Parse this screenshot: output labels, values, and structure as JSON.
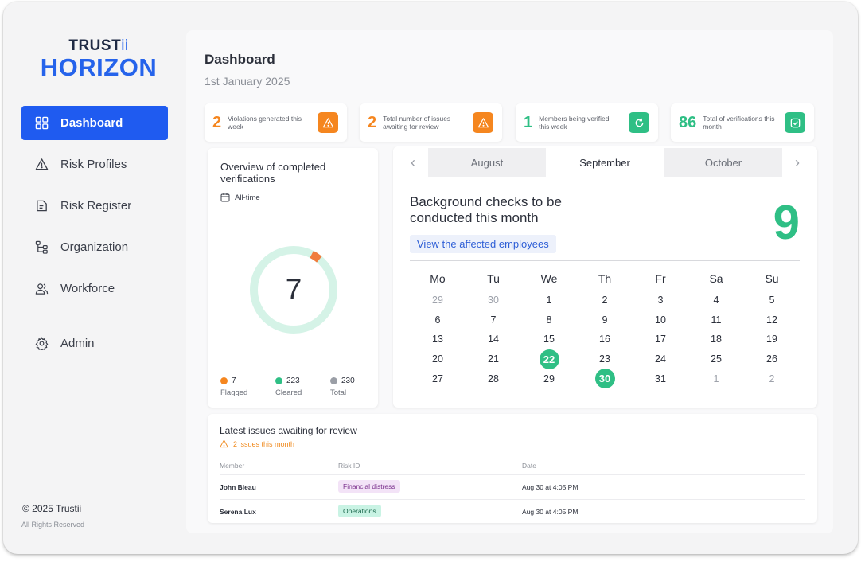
{
  "brand": {
    "top_text": "TRUST",
    "top_accent": "ii",
    "main": "HORIZON"
  },
  "nav": [
    {
      "label": "Dashboard",
      "icon": "grid-icon",
      "active": true
    },
    {
      "label": "Risk Profiles",
      "icon": "warning-icon"
    },
    {
      "label": "Risk Register",
      "icon": "document-icon"
    },
    {
      "label": "Organization",
      "icon": "hierarchy-icon"
    },
    {
      "label": "Workforce",
      "icon": "users-icon"
    },
    {
      "label": "Admin",
      "icon": "gear-icon"
    }
  ],
  "footer": {
    "copyright": "© 2025 Trustii",
    "rights": "All Rights Reserved"
  },
  "header": {
    "title": "Dashboard",
    "date": "1st January 2025"
  },
  "stats": [
    {
      "value": "2",
      "label": "Violations generated this week",
      "icon": "warning-icon",
      "color": "#f5861f"
    },
    {
      "value": "2",
      "label": "Total number of issues awaiting for review",
      "icon": "warning-icon",
      "color": "#f5861f"
    },
    {
      "value": "1",
      "label": "Members being verified this week",
      "icon": "refresh-icon",
      "color": "#2fbf85"
    },
    {
      "value": "86",
      "label": "Total of verifications this month",
      "icon": "check-icon",
      "color": "#2fbf85"
    }
  ],
  "overview": {
    "title": "Overview of completed verifications",
    "filter": "All-time",
    "center_value": "7",
    "legend": [
      {
        "value": "7",
        "label": "Flagged",
        "color": "#f5861f"
      },
      {
        "value": "223",
        "label": "Cleared",
        "color": "#2fbf85"
      },
      {
        "value": "230",
        "label": "Total",
        "color": "#9a9ea6"
      }
    ],
    "flagged_fraction": 0.0304
  },
  "calendar": {
    "prev_arrow": "‹",
    "next_arrow": "›",
    "months": [
      "August",
      "September",
      "October"
    ],
    "current_month": "September",
    "heading": "Background checks to be conducted this month",
    "count": "9",
    "link": "View the affected employees",
    "weekdays": [
      "Mo",
      "Tu",
      "We",
      "Th",
      "Fr",
      "Sa",
      "Su"
    ],
    "weeks": [
      [
        "29",
        "30",
        "1",
        "2",
        "3",
        "4",
        "5"
      ],
      [
        "6",
        "7",
        "8",
        "9",
        "10",
        "11",
        "12"
      ],
      [
        "13",
        "14",
        "15",
        "16",
        "17",
        "18",
        "19"
      ],
      [
        "20",
        "21",
        "22",
        "23",
        "24",
        "25",
        "26"
      ],
      [
        "27",
        "28",
        "29",
        "30",
        "31",
        "1",
        "2"
      ]
    ],
    "muted": [
      [
        0,
        0
      ],
      [
        0,
        1
      ],
      [
        4,
        5
      ],
      [
        4,
        6
      ]
    ],
    "highlighted": [
      [
        3,
        2
      ],
      [
        4,
        3
      ]
    ],
    "highlight_color": "#2fbf85"
  },
  "issues": {
    "title": "Latest issues awaiting for review",
    "subtitle": "2 issues this month",
    "columns": [
      "Member",
      "Risk ID",
      "Date"
    ],
    "rows": [
      {
        "member": "John Bleau",
        "risk": "Financial distress",
        "risk_bg": "#f3e3f7",
        "risk_color": "#7a2f8c",
        "date": "Aug 30 at 4:05 PM"
      },
      {
        "member": "Serena Lux",
        "risk": "Operations",
        "risk_bg": "#c9f3e4",
        "risk_color": "#1f6b50",
        "date": "Aug 30 at 4:05 PM"
      }
    ]
  }
}
